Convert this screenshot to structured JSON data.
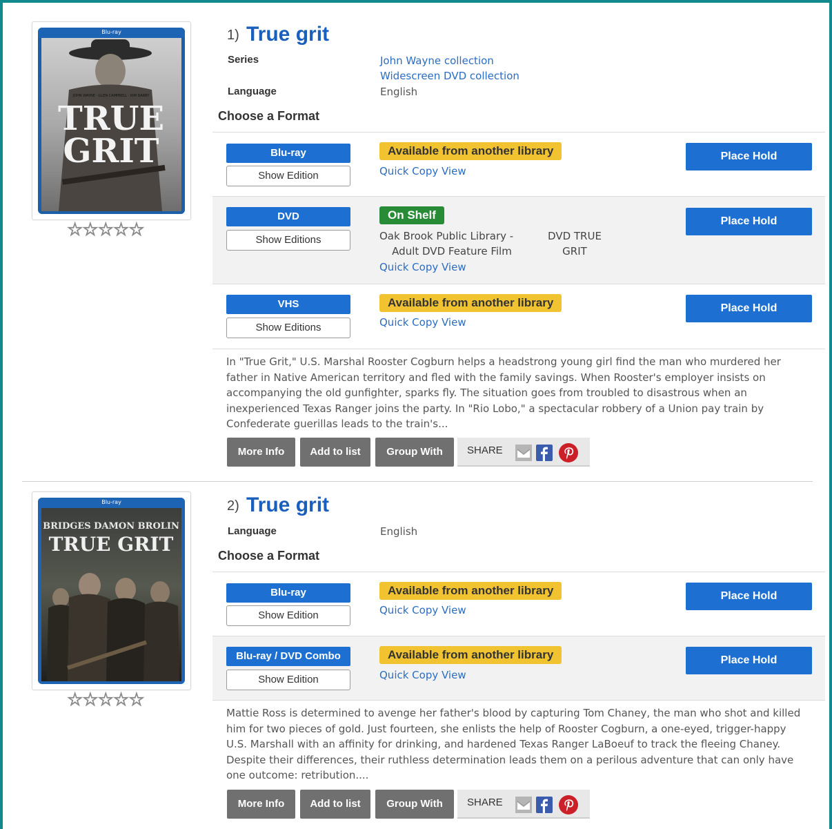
{
  "records": [
    {
      "number": "1)",
      "title": "True grit",
      "cover": {
        "brand": "Blu-ray",
        "title_line1": "TRUE",
        "title_line2": "GRIT",
        "credits": "JOHN WAYNE · GLEN CAMPBELL · KIM DARBY"
      },
      "rating_stars": "☆☆☆☆☆",
      "series_label": "Series",
      "series": [
        "John Wayne collection",
        "Widescreen DVD collection"
      ],
      "language_label": "Language",
      "language": "English",
      "choose_format": "Choose a Format",
      "formats": [
        {
          "name": "Blu-ray",
          "edition_btn": "Show Edition",
          "status": "Available from another library",
          "status_type": "available",
          "quick_copy": "Quick Copy View",
          "hold": "Place Hold"
        },
        {
          "name": "DVD",
          "edition_btn": "Show Editions",
          "status": "On Shelf",
          "status_type": "onshelf",
          "location_line1": "Oak Brook Public Library -",
          "location_line2": "Adult DVD Feature Film",
          "call_line1": "DVD TRUE",
          "call_line2": "GRIT",
          "quick_copy": "Quick Copy View",
          "hold": "Place Hold"
        },
        {
          "name": "VHS",
          "edition_btn": "Show Editions",
          "status": "Available from another library",
          "status_type": "available",
          "quick_copy": "Quick Copy View",
          "hold": "Place Hold"
        }
      ],
      "description_lines": [
        "In \"True Grit,\" U.S. Marshal Rooster Cogburn helps a headstrong young girl find the man who murdered her",
        "father in Native American territory and fled with the family savings. When Rooster's employer insists on",
        "accompanying the old gunfighter, sparks fly. The situation goes from troubled to disastrous when an",
        "inexperienced Texas Ranger joins the party. In \"Rio Lobo,\" a spectacular robbery of a Union pay train by",
        "Confederate guerillas leads to the train's..."
      ],
      "actions": {
        "more_info": "More Info",
        "add_to_list": "Add to list",
        "group_with": "Group With",
        "share": "SHARE"
      }
    },
    {
      "number": "2)",
      "title": "True grit",
      "cover": {
        "brand": "Blu-ray",
        "title_line1": "TRUE GRIT",
        "credits": "BRIDGES  DAMON  BROLIN"
      },
      "rating_stars": "☆☆☆☆☆",
      "language_label": "Language",
      "language": "English",
      "choose_format": "Choose a Format",
      "formats": [
        {
          "name": "Blu-ray",
          "edition_btn": "Show Edition",
          "status": "Available from another library",
          "status_type": "available",
          "quick_copy": "Quick Copy View",
          "hold": "Place Hold"
        },
        {
          "name": "Blu-ray / DVD Combo",
          "edition_btn": "Show Edition",
          "status": "Available from another library",
          "status_type": "available",
          "quick_copy": "Quick Copy View",
          "hold": "Place Hold"
        }
      ],
      "description_lines": [
        "Mattie Ross is determined to avenge her father's blood by capturing Tom Chaney, the man who shot and killed",
        "him for two pieces of gold. Just fourteen, she enlists the help of Rooster Cogburn, a one-eyed, trigger-happy",
        "U.S. Marshall with an affinity for drinking, and hardened Texas Ranger LaBoeuf to track the fleeing Chaney.",
        "Despite their differences, their ruthless determination leads them on a perilous adventure that can only have",
        "one outcome: retribution...."
      ],
      "actions": {
        "more_info": "More Info",
        "add_to_list": "Add to list",
        "group_with": "Group With",
        "share": "SHARE"
      }
    }
  ],
  "colors": {
    "frame": "#128a8d",
    "primary_button": "#1d6fd1",
    "link": "#2b6dc2",
    "available_badge": "#f2c330",
    "on_shelf_badge": "#288b35",
    "action_button": "#707070"
  },
  "icons": [
    "email-icon",
    "facebook-icon",
    "pinterest-icon",
    "star-outline-icon"
  ]
}
